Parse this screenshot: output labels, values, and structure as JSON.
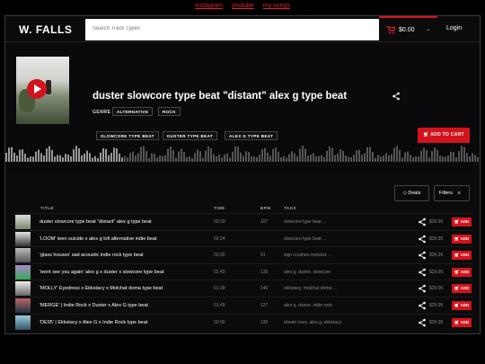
{
  "top_links": [
    "instagram",
    "youtube",
    "my songs"
  ],
  "header": {
    "logo": "W. FALLS",
    "search_placeholder": "Search Track Types",
    "cart_amount": "$0.00",
    "login": "Login"
  },
  "hero": {
    "title": "duster slowcore type beat \"distant\" alex g type beat",
    "genre_label": "GENRE",
    "genres": [
      "ALTERNATIVE",
      "ROCK"
    ],
    "tags": [
      "SLOWCORE TYPE BEAT",
      "DUSTER TYPE BEAT",
      "ALEX G TYPE BEAT"
    ],
    "add_to_cart": "ADD TO CART"
  },
  "controls": {
    "deals": "Deals",
    "filters": "Filters"
  },
  "table": {
    "headers": {
      "title": "TITLE",
      "time": "TIME",
      "bpm": "BPM",
      "tags": "TAGS"
    },
    "rows": [
      {
        "title": "duster slowcore type beat \"distant\" alex g type beat",
        "time": "03:33",
        "bpm": "107",
        "tags": "slowcore type beat ...",
        "price": "$29.95",
        "add": "ADD"
      },
      {
        "title": "'LOOM' teen suicide x alex g lofi alternative indie beat",
        "time": "02:24",
        "bpm": "",
        "tags": "slowcore type beat ...",
        "price": "$29.95",
        "add": "ADD"
      },
      {
        "title": "'glass houses' sad acoustic indie rock type beat",
        "time": "02:05",
        "bpm": "91",
        "tags": "sign crushes motorist ...",
        "price": "$29.95",
        "add": "ADD"
      },
      {
        "title": "'wont see you again' alex g x duster x slowcore type beat",
        "time": "02:43",
        "bpm": "135",
        "tags": "alex g. duster. slowcore",
        "price": "$29.95",
        "add": "ADD"
      },
      {
        "title": "'MOLLY' Eyedress x Ekkstacy x Molchat doma type beat",
        "time": "01:39",
        "bpm": "140",
        "tags": "ekkstacy. molchat doma ...",
        "price": "$29.95",
        "add": "ADD"
      },
      {
        "title": "'MERGE' | Indie Rock x Duster x Alex G type beat",
        "time": "01:49",
        "bpm": "127",
        "tags": "alex g. duster. indie rock",
        "price": "$29.95",
        "add": "ADD"
      },
      {
        "title": "'DE95' | Ekkstacy x Alex G x Indie Rock type beat",
        "time": "02:00",
        "bpm": "135",
        "tags": "dream ivory. alex g. ekkstacy",
        "price": "$29.95",
        "add": "ADD"
      }
    ]
  }
}
